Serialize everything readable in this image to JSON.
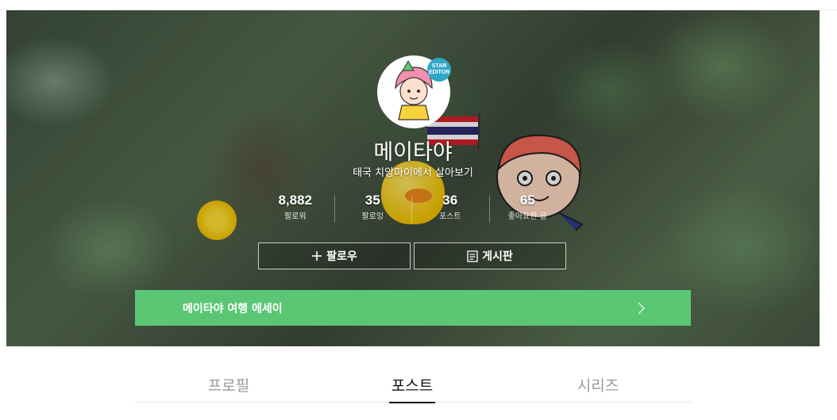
{
  "profile": {
    "name": "메이타야",
    "tagline": "태국 치앙마이에서 살아보기",
    "badge": "STAR EDITOR"
  },
  "stats": [
    {
      "value": "8,882",
      "label": "팔로워"
    },
    {
      "value": "35",
      "label": "팔로잉"
    },
    {
      "value": "36",
      "label": "포스트"
    },
    {
      "value": "65",
      "label": "좋아요한 글"
    }
  ],
  "buttons": {
    "follow": "팔로우",
    "board": "게시판"
  },
  "series_banner": {
    "title": "메이타야 여행 에세이"
  },
  "tabs": [
    {
      "label": "프로필",
      "active": false
    },
    {
      "label": "포스트",
      "active": true
    },
    {
      "label": "시리즈",
      "active": false
    }
  ],
  "colors": {
    "accent_green": "#5bc775",
    "badge_blue": "#2fa7c8"
  }
}
